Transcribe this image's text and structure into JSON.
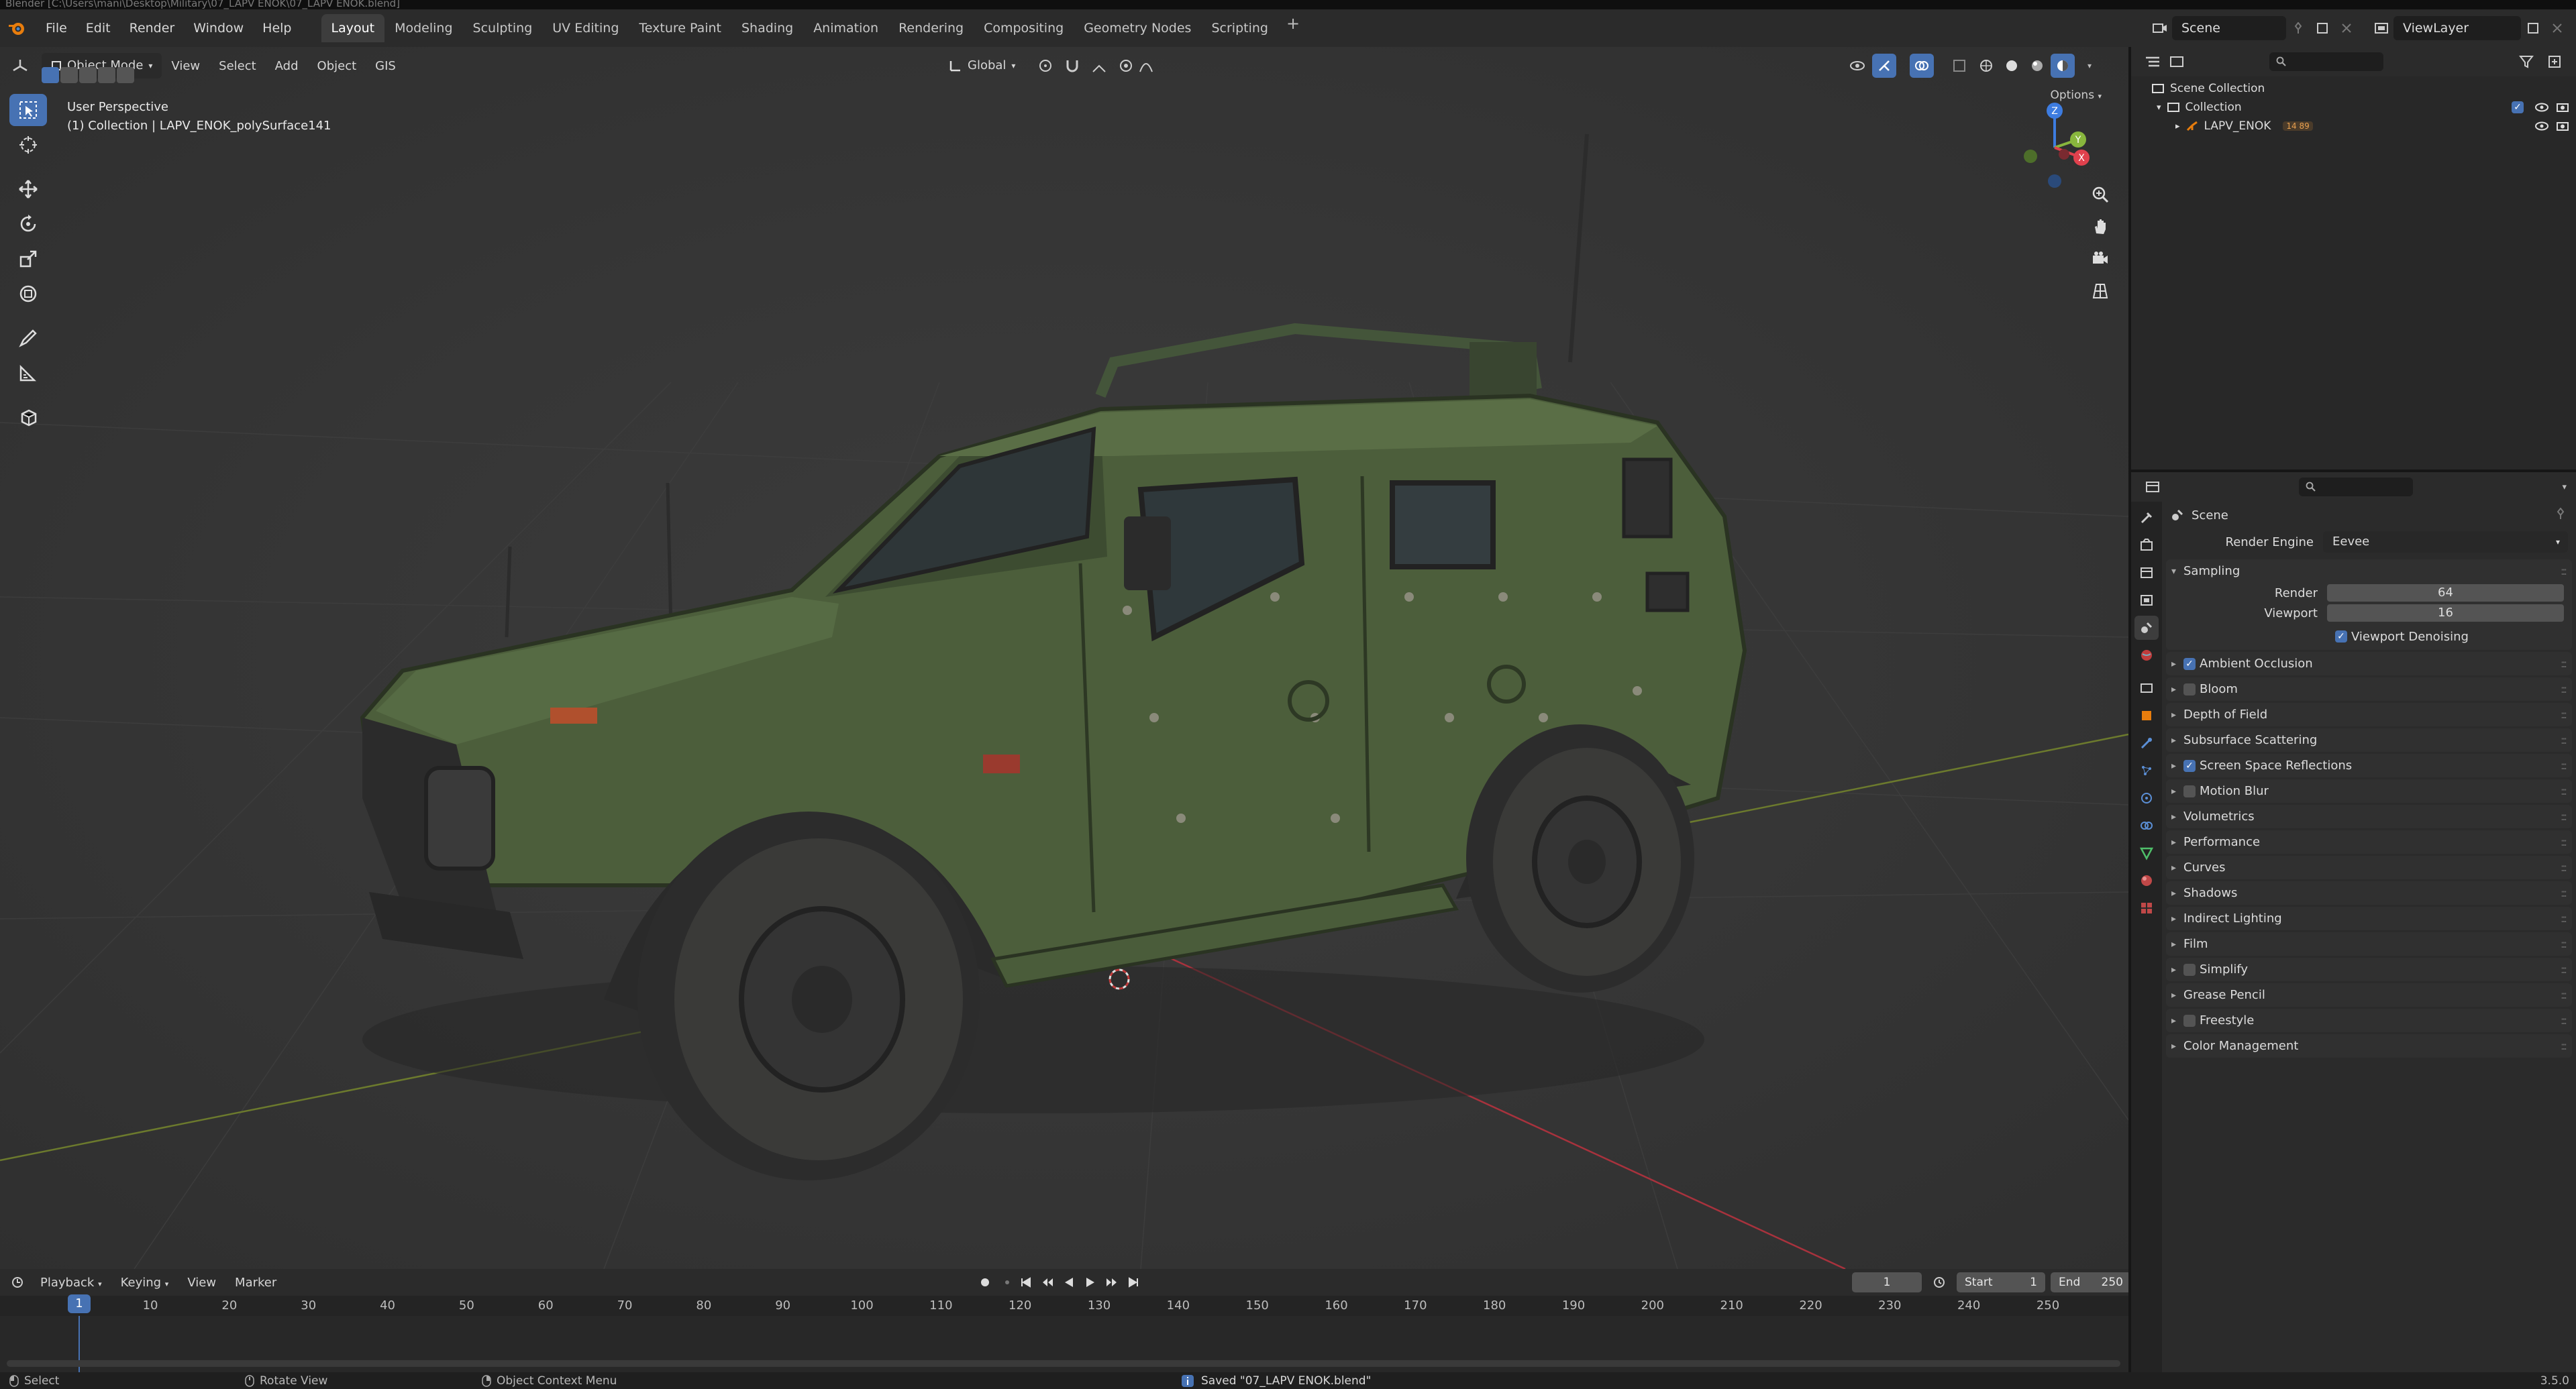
{
  "window": {
    "title": "Blender [C:\\Users\\mani\\Desktop\\Military\\07_LAPV ENOK\\07_LAPV ENOK.blend]"
  },
  "topbar": {
    "menus": [
      "File",
      "Edit",
      "Render",
      "Window",
      "Help"
    ],
    "workspaces": [
      "Layout",
      "Modeling",
      "Sculpting",
      "UV Editing",
      "Texture Paint",
      "Shading",
      "Animation",
      "Rendering",
      "Compositing",
      "Geometry Nodes",
      "Scripting"
    ],
    "active_workspace": "Layout",
    "add_tab": "+",
    "scene": "Scene",
    "view_layer": "ViewLayer"
  },
  "viewport": {
    "mode": "Object Mode",
    "menus": [
      "View",
      "Select",
      "Add",
      "Object",
      "GIS"
    ],
    "orientation": "Global",
    "options": "Options",
    "info_line1": "User Perspective",
    "info_line2": "(1) Collection | LAPV_ENOK_polySurface141",
    "gizmo": {
      "x": "X",
      "y": "Y",
      "z": "Z"
    }
  },
  "timeline": {
    "playback": "Playback",
    "keying": "Keying",
    "view": "View",
    "marker": "Marker",
    "current_frame": "1",
    "start_label": "Start",
    "start": "1",
    "end_label": "End",
    "end": "250",
    "ruler": [
      "10",
      "20",
      "30",
      "40",
      "50",
      "60",
      "70",
      "80",
      "90",
      "100",
      "110",
      "120",
      "130",
      "140",
      "150",
      "160",
      "170",
      "180",
      "190",
      "200",
      "210",
      "220",
      "230",
      "240",
      "250"
    ]
  },
  "status": {
    "select": "Select",
    "rotate": "Rotate View",
    "context": "Object Context Menu",
    "saved": "Saved \"07_LAPV ENOK.blend\"",
    "version": "3.5.0"
  },
  "outliner": {
    "scene_collection": "Scene Collection",
    "collection": "Collection",
    "object": "LAPV_ENOK",
    "object_badge": "14 89"
  },
  "properties": {
    "context": "Scene",
    "render_engine_label": "Render Engine",
    "render_engine": "Eevee",
    "sampling": {
      "title": "Sampling",
      "render_label": "Render",
      "render": "64",
      "viewport_label": "Viewport",
      "viewport": "16",
      "denoise": "Viewport Denoising"
    },
    "panels": [
      {
        "label": "Ambient Occlusion",
        "check": "on"
      },
      {
        "label": "Bloom",
        "check": "off"
      },
      {
        "label": "Depth of Field",
        "check": "none"
      },
      {
        "label": "Subsurface Scattering",
        "check": "none"
      },
      {
        "label": "Screen Space Reflections",
        "check": "on"
      },
      {
        "label": "Motion Blur",
        "check": "off"
      },
      {
        "label": "Volumetrics",
        "check": "none"
      },
      {
        "label": "Performance",
        "check": "none"
      },
      {
        "label": "Curves",
        "check": "none"
      },
      {
        "label": "Shadows",
        "check": "none"
      },
      {
        "label": "Indirect Lighting",
        "check": "none"
      },
      {
        "label": "Film",
        "check": "none"
      },
      {
        "label": "Simplify",
        "check": "off"
      },
      {
        "label": "Grease Pencil",
        "check": "none"
      },
      {
        "label": "Freestyle",
        "check": "off"
      },
      {
        "label": "Color Management",
        "check": "none"
      }
    ]
  },
  "colors": {
    "accent": "#4772b3",
    "vehicle": "#4b5e3a",
    "x_axis": "#e0414d",
    "y_axis": "#88b63d",
    "z_axis": "#3d7ce0"
  }
}
